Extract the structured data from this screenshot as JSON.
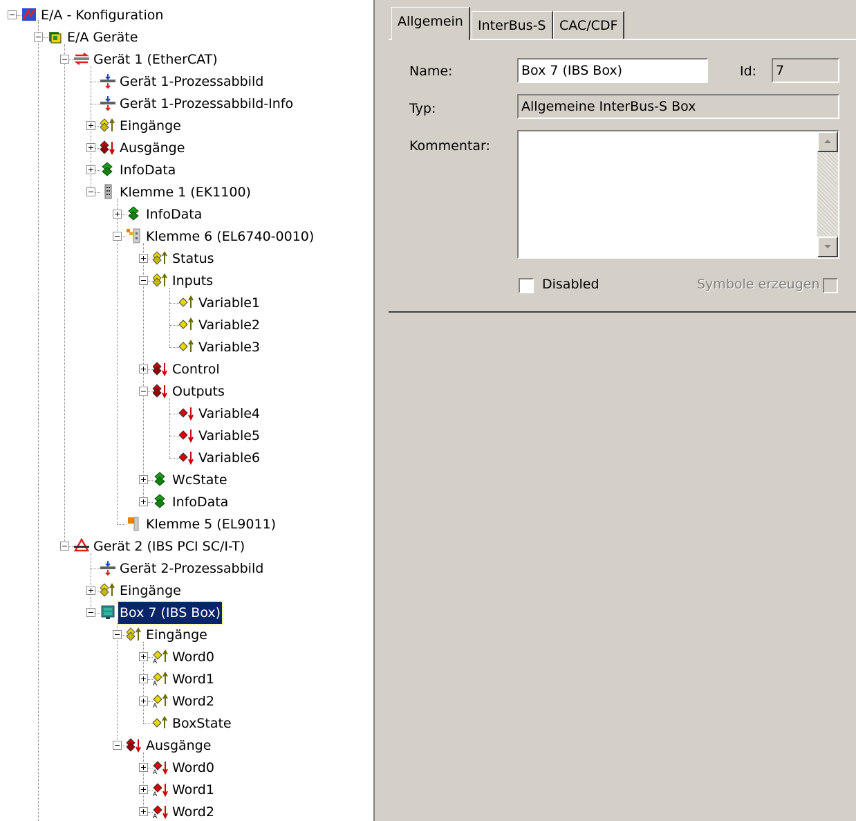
{
  "tree": {
    "selected_index": 27,
    "items": [
      {
        "label": "E/A - Konfiguration",
        "level": 0,
        "expander": "minus",
        "icon": "io-config-icon"
      },
      {
        "label": "E/A Geräte",
        "level": 1,
        "expander": "minus",
        "icon": "io-devices-icon"
      },
      {
        "label": "Gerät 1 (EtherCAT)",
        "level": 2,
        "expander": "minus",
        "icon": "ethercat-device-icon"
      },
      {
        "label": "Gerät 1-Prozessabbild",
        "level": 3,
        "expander": "none",
        "icon": "process-image-icon"
      },
      {
        "label": "Gerät 1-Prozessabbild-Info",
        "level": 3,
        "expander": "none",
        "icon": "process-image-icon"
      },
      {
        "label": "Eingänge",
        "level": 3,
        "expander": "plus",
        "icon": "inputs-icon"
      },
      {
        "label": "Ausgänge",
        "level": 3,
        "expander": "plus",
        "icon": "outputs-icon"
      },
      {
        "label": "InfoData",
        "level": 3,
        "expander": "plus",
        "icon": "infodata-icon"
      },
      {
        "label": "Klemme 1 (EK1100)",
        "level": 3,
        "expander": "minus",
        "icon": "terminal-coupler-icon"
      },
      {
        "label": "InfoData",
        "level": 4,
        "expander": "plus",
        "icon": "infodata-icon"
      },
      {
        "label": "Klemme 6 (EL6740-0010)",
        "level": 4,
        "expander": "minus",
        "icon": "terminal-icon"
      },
      {
        "label": "Status",
        "level": 5,
        "expander": "plus",
        "icon": "inputs-icon"
      },
      {
        "label": "Inputs",
        "level": 5,
        "expander": "minus",
        "icon": "inputs-icon"
      },
      {
        "label": "Variable1",
        "level": 6,
        "expander": "none",
        "icon": "input-variable-icon"
      },
      {
        "label": "Variable2",
        "level": 6,
        "expander": "none",
        "icon": "input-variable-icon"
      },
      {
        "label": "Variable3",
        "level": 6,
        "expander": "none",
        "icon": "input-variable-icon"
      },
      {
        "label": "Control",
        "level": 5,
        "expander": "plus",
        "icon": "outputs-icon"
      },
      {
        "label": "Outputs",
        "level": 5,
        "expander": "minus",
        "icon": "outputs-icon"
      },
      {
        "label": "Variable4",
        "level": 6,
        "expander": "none",
        "icon": "output-variable-icon"
      },
      {
        "label": "Variable5",
        "level": 6,
        "expander": "none",
        "icon": "output-variable-icon"
      },
      {
        "label": "Variable6",
        "level": 6,
        "expander": "none",
        "icon": "output-variable-icon"
      },
      {
        "label": "WcState",
        "level": 5,
        "expander": "plus",
        "icon": "infodata-icon"
      },
      {
        "label": "InfoData",
        "level": 5,
        "expander": "plus",
        "icon": "infodata-icon"
      },
      {
        "label": "Klemme 5 (EL9011)",
        "level": 4,
        "expander": "none",
        "icon": "end-terminal-icon"
      },
      {
        "label": "Gerät 2 (IBS PCI SC/I-T)",
        "level": 2,
        "expander": "minus",
        "icon": "interbus-device-icon"
      },
      {
        "label": "Gerät 2-Prozessabbild",
        "level": 3,
        "expander": "none",
        "icon": "process-image-icon"
      },
      {
        "label": "Eingänge",
        "level": 3,
        "expander": "plus",
        "icon": "inputs-icon"
      },
      {
        "label": "Box 7 (IBS Box)",
        "level": 3,
        "expander": "minus",
        "icon": "ibs-box-icon"
      },
      {
        "label": "Eingänge",
        "level": 4,
        "expander": "minus",
        "icon": "inputs-icon"
      },
      {
        "label": "Word0",
        "level": 5,
        "expander": "plus",
        "icon": "input-word-icon"
      },
      {
        "label": "Word1",
        "level": 5,
        "expander": "plus",
        "icon": "input-word-icon"
      },
      {
        "label": "Word2",
        "level": 5,
        "expander": "plus",
        "icon": "input-word-icon"
      },
      {
        "label": "BoxState",
        "level": 5,
        "expander": "none",
        "icon": "input-variable-icon"
      },
      {
        "label": "Ausgänge",
        "level": 4,
        "expander": "minus",
        "icon": "outputs-icon"
      },
      {
        "label": "Word0",
        "level": 5,
        "expander": "plus",
        "icon": "output-word-icon"
      },
      {
        "label": "Word1",
        "level": 5,
        "expander": "plus",
        "icon": "output-word-icon"
      },
      {
        "label": "Word2",
        "level": 5,
        "expander": "plus",
        "icon": "output-word-icon"
      }
    ]
  },
  "tabs": [
    {
      "label": "Allgemein",
      "active": true
    },
    {
      "label": "InterBus-S",
      "active": false
    },
    {
      "label": "CAC/CDF",
      "active": false
    }
  ],
  "form": {
    "name_label": "Name:",
    "name_value": "Box 7 (IBS Box)",
    "id_label": "Id:",
    "id_value": "7",
    "type_label": "Typ:",
    "type_value": "Allgemeine InterBus-S Box",
    "comment_label": "Kommentar:",
    "comment_value": "",
    "disabled_label": "Disabled",
    "disabled_checked": false,
    "symbols_label": "Symbole erzeugen",
    "symbols_checked": false
  },
  "colors": {
    "selection": "#0a246a",
    "window_bg": "#d4d0c8",
    "input_icon": "#e8d800",
    "output_icon": "#cc0000",
    "infodata_icon": "#1a9a1a"
  }
}
